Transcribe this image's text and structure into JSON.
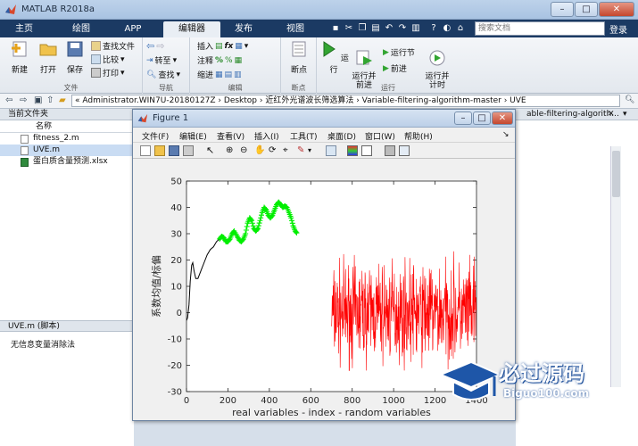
{
  "window": {
    "title": "MATLAB R2018a"
  },
  "tabs": [
    {
      "label": "主页"
    },
    {
      "label": "绘图"
    },
    {
      "label": "APP"
    },
    {
      "label": "编辑器",
      "active": true
    },
    {
      "label": "发布"
    },
    {
      "label": "视图"
    }
  ],
  "search": {
    "placeholder": "搜索文档"
  },
  "login": "登录",
  "toolstrip": {
    "file": {
      "label": "文件",
      "new": "新建",
      "open": "打开",
      "save": "保存",
      "find_files": "查找文件",
      "compare": "比较",
      "print": "打印"
    },
    "nav": {
      "label": "导航",
      "goto": "转至",
      "find": "查找"
    },
    "edit": {
      "label": "编辑",
      "insert": "插入",
      "comment": "注释",
      "indent": "缩进"
    },
    "breakpoints": {
      "label": "断点",
      "breakpoint": "断点"
    },
    "run": {
      "label": "运行",
      "run": "运行",
      "run_advance": "运行并\n前进",
      "run_section": "运行节",
      "advance": "前进",
      "run_time": "运行并\n计时"
    }
  },
  "address": {
    "path": "« Administrator.WIN7U-20180127Z  ›  Desktop  ›  近红外光谱波长筛选算法  ›  Variable-filtering-algorithm-master  ›  UVE"
  },
  "current_folder": {
    "title": "当前文件夹",
    "column": "名称",
    "files": [
      {
        "name": "fitness_2.m",
        "selected": false
      },
      {
        "name": "UVE.m",
        "selected": true
      },
      {
        "name": "蛋白质含量预测.xlsx",
        "selected": false
      }
    ]
  },
  "details": {
    "title": "UVE.m  (脚本)",
    "text": "无信息变量消除法"
  },
  "editor": {
    "tab_text": "able-filtering-algorith..."
  },
  "figure": {
    "title": "Figure 1",
    "menu": [
      "文件(F)",
      "编辑(E)",
      "查看(V)",
      "插入(I)",
      "工具(T)",
      "桌面(D)",
      "窗口(W)",
      "帮助(H)"
    ]
  },
  "chart_data": {
    "type": "line",
    "xlabel": "real variables - index - random variables",
    "ylabel": "系数均值/标偏",
    "xlim": [
      0,
      1400
    ],
    "ylim": [
      -30,
      50
    ],
    "xticks": [
      0,
      200,
      400,
      600,
      800,
      1000,
      1200,
      1400
    ],
    "yticks": [
      -30,
      -20,
      -10,
      0,
      10,
      20,
      30,
      40,
      50
    ],
    "series": [
      {
        "color": "#000000",
        "points": [
          [
            0,
            -3
          ],
          [
            5,
            -2
          ],
          [
            12,
            3
          ],
          [
            18,
            12
          ],
          [
            25,
            18
          ],
          [
            30,
            19
          ],
          [
            36,
            16
          ],
          [
            45,
            13
          ],
          [
            55,
            13
          ],
          [
            65,
            15
          ],
          [
            75,
            17
          ],
          [
            85,
            19
          ],
          [
            100,
            22
          ],
          [
            115,
            24
          ],
          [
            130,
            25
          ],
          [
            145,
            27
          ],
          [
            160,
            28
          ]
        ]
      },
      {
        "color": "#00ee00",
        "marker": "+",
        "points": [
          [
            160,
            28
          ],
          [
            170,
            29
          ],
          [
            180,
            28.5
          ],
          [
            190,
            27
          ],
          [
            200,
            27
          ],
          [
            210,
            28
          ],
          [
            220,
            30
          ],
          [
            230,
            31
          ],
          [
            245,
            29
          ],
          [
            255,
            27.5
          ],
          [
            265,
            27
          ],
          [
            275,
            28
          ],
          [
            285,
            30
          ],
          [
            295,
            34
          ],
          [
            305,
            36
          ],
          [
            315,
            35
          ],
          [
            325,
            32
          ],
          [
            335,
            31
          ],
          [
            345,
            32
          ],
          [
            355,
            35
          ],
          [
            365,
            38
          ],
          [
            375,
            40
          ],
          [
            385,
            39
          ],
          [
            395,
            37
          ],
          [
            405,
            36
          ],
          [
            415,
            37
          ],
          [
            425,
            39
          ],
          [
            435,
            41
          ],
          [
            445,
            42
          ],
          [
            455,
            41
          ],
          [
            465,
            40
          ],
          [
            475,
            40.5
          ],
          [
            485,
            40
          ],
          [
            495,
            38
          ],
          [
            505,
            36
          ],
          [
            515,
            33
          ],
          [
            525,
            31
          ],
          [
            535,
            30
          ]
        ]
      }
    ],
    "random_series": {
      "color": "#ff0000",
      "x_range": [
        701,
        1400
      ],
      "y_range": [
        -22,
        27
      ],
      "center": 0
    }
  },
  "watermark": {
    "title": "必过源码",
    "url": "Biguo100.com"
  }
}
